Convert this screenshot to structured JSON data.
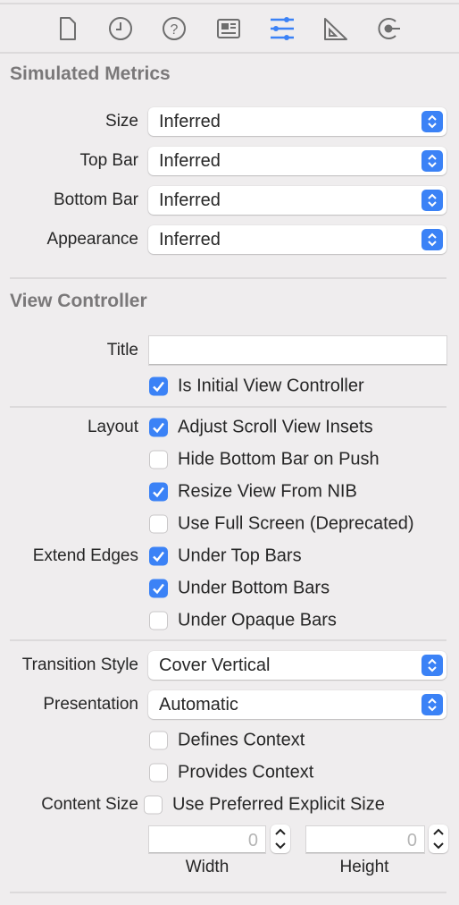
{
  "toolbar": {
    "tabs": [
      {
        "icon": "file-icon",
        "active": false
      },
      {
        "icon": "clock-icon",
        "active": false
      },
      {
        "icon": "help-icon",
        "active": false
      },
      {
        "icon": "identity-card-icon",
        "active": false
      },
      {
        "icon": "sliders-icon",
        "active": true
      },
      {
        "icon": "ruler-icon",
        "active": false
      },
      {
        "icon": "connections-icon",
        "active": false
      }
    ],
    "accent": "#3b82f6"
  },
  "simulated_metrics": {
    "title": "Simulated Metrics",
    "rows": [
      {
        "label": "Size",
        "value": "Inferred"
      },
      {
        "label": "Top Bar",
        "value": "Inferred"
      },
      {
        "label": "Bottom Bar",
        "value": "Inferred"
      },
      {
        "label": "Appearance",
        "value": "Inferred"
      }
    ]
  },
  "view_controller": {
    "title": "View Controller",
    "title_label": "Title",
    "title_value": "",
    "initial": {
      "label": "Is Initial View Controller",
      "checked": true
    },
    "layout_label": "Layout",
    "layout": [
      {
        "label": "Adjust Scroll View Insets",
        "checked": true
      },
      {
        "label": "Hide Bottom Bar on Push",
        "checked": false
      },
      {
        "label": "Resize View From NIB",
        "checked": true
      },
      {
        "label": "Use Full Screen (Deprecated)",
        "checked": false
      }
    ],
    "extend_label": "Extend Edges",
    "extend": [
      {
        "label": "Under Top Bars",
        "checked": true
      },
      {
        "label": "Under Bottom Bars",
        "checked": true
      },
      {
        "label": "Under Opaque Bars",
        "checked": false
      }
    ],
    "transition_label": "Transition Style",
    "transition_value": "Cover Vertical",
    "presentation_label": "Presentation",
    "presentation_value": "Automatic",
    "defines": {
      "label": "Defines Context",
      "checked": false
    },
    "provides": {
      "label": "Provides Context",
      "checked": false
    },
    "content_size_label": "Content Size",
    "preferred": {
      "label": "Use Preferred Explicit Size",
      "checked": false
    },
    "width": {
      "value": "0",
      "label": "Width"
    },
    "height": {
      "value": "0",
      "label": "Height"
    }
  }
}
